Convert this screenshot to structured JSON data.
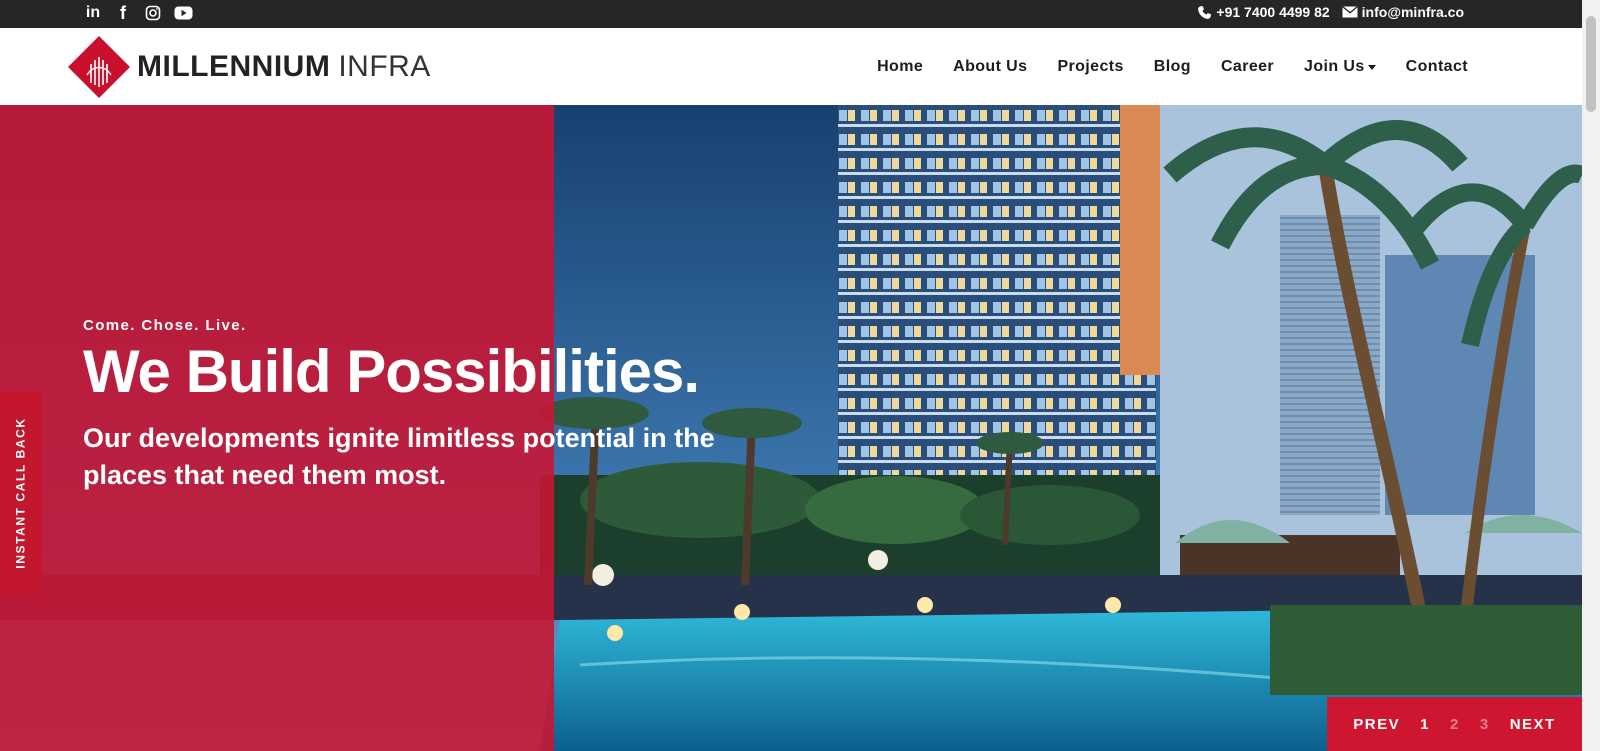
{
  "topbar": {
    "social": [
      {
        "name": "linkedin",
        "glyph": "in"
      },
      {
        "name": "facebook",
        "glyph": "f"
      },
      {
        "name": "instagram",
        "glyph": ""
      },
      {
        "name": "youtube",
        "glyph": ""
      }
    ],
    "phone": "+91 7400 4499 82",
    "email": "info@minfra.co"
  },
  "header": {
    "logo_bold": "MILLENNIUM",
    "logo_light": "INFRA",
    "nav": [
      "Home",
      "About Us",
      "Projects",
      "Blog",
      "Career",
      "Join Us",
      "Contact"
    ]
  },
  "hero": {
    "tagline": "Come. Chose. Live.",
    "headline": "We Build Possibilities.",
    "subline": "Our developments ignite limitless potential in the places that need them most.",
    "callback_label": "INSTANT CALL BACK"
  },
  "pager": {
    "prev": "PREV",
    "pages": [
      "1",
      "2",
      "3"
    ],
    "current": "1",
    "next": "NEXT"
  },
  "colors": {
    "brand_red": "#c8102e",
    "topbar_bg": "#262626",
    "nav_text": "#1d1d1d"
  }
}
